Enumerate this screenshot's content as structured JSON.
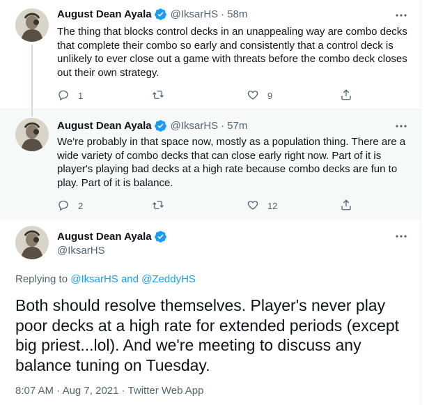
{
  "tweets": [
    {
      "author": "August Dean Ayala",
      "handle": "@IksarHS",
      "time": "58m",
      "dot": "·",
      "text": "The thing that blocks control decks in an unappealing way are combo decks that complete their combo so early and consistently that a control deck is unlikely to ever close out a game with threats before the combo deck closes out their own strategy.",
      "replies": "1",
      "likes": "9"
    },
    {
      "author": "August Dean Ayala",
      "handle": "@IksarHS",
      "time": "57m",
      "dot": "·",
      "text": "We're probably in that space now, mostly as a population thing. There are a wide variety of combo decks that can close early right now. Part of it is player's playing bad decks at a high rate because combo decks are fun to play. Part of it is balance.",
      "replies": "2",
      "likes": "12"
    }
  ],
  "main_tweet": {
    "author": "August Dean Ayala",
    "handle": "@IksarHS",
    "replying_label": "Replying to",
    "reply_user_1": "@IksarHS",
    "reply_and": "and",
    "reply_user_2": "@ZeddyHS",
    "text": "Both should resolve themselves. Player's never play poor decks at a high rate for extended periods (except big priest...lol). And we're meeting to discuss any balance tuning on Tuesday.",
    "time": "8:07 AM",
    "date": "Aug 7, 2021",
    "app": "Twitter Web App",
    "sep": "·"
  },
  "colors": {
    "accent": "#1d9bf0",
    "secondary_text": "#536471",
    "highlight_bg": "#f7f9f9"
  },
  "icons": [
    "verified-badge-icon",
    "more-icon",
    "reply-icon",
    "retweet-icon",
    "like-icon",
    "share-icon"
  ]
}
